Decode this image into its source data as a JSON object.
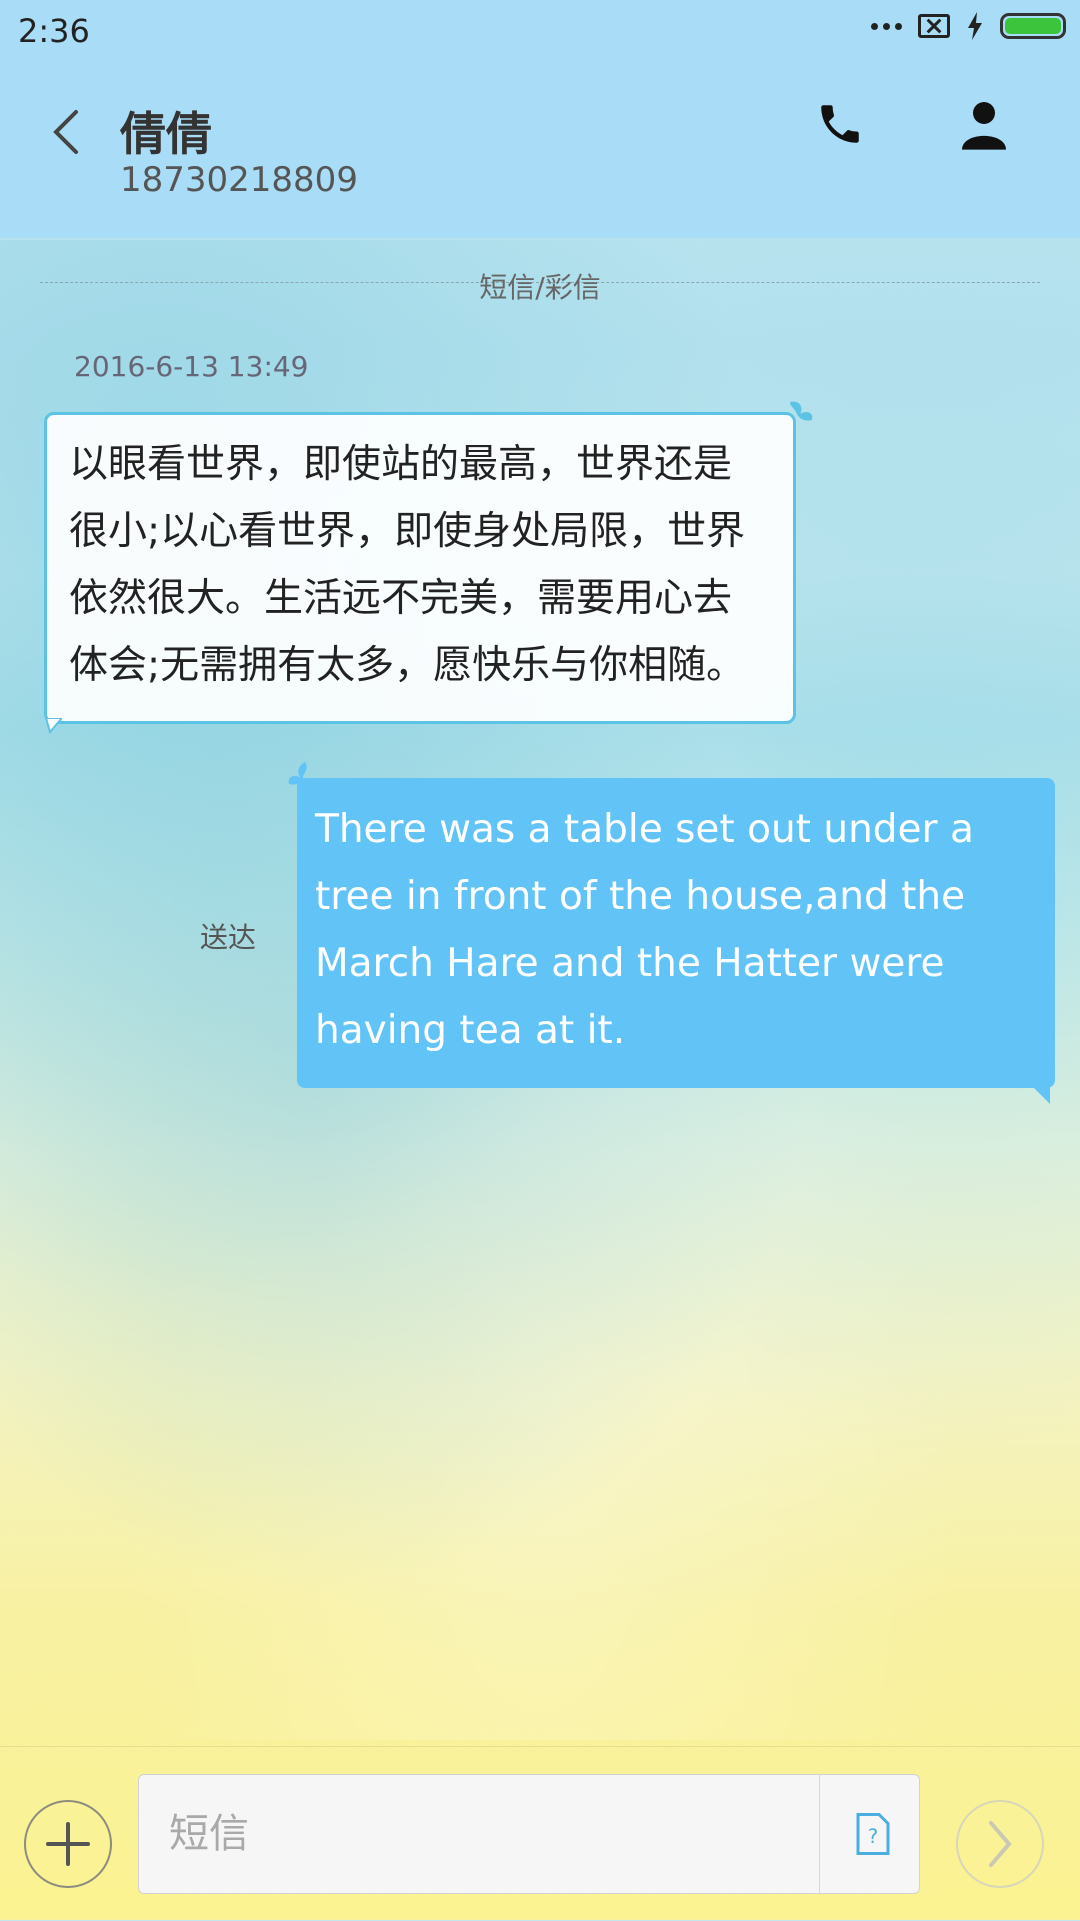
{
  "status_bar": {
    "time": "2:36"
  },
  "header": {
    "contact_name": "倩倩",
    "contact_number": "18730218809",
    "icons": [
      "back-arrow-icon",
      "phone-icon",
      "person-icon"
    ]
  },
  "conversation": {
    "section_label": "短信/彩信",
    "timestamp": "2016-6-13 13:49",
    "incoming_message": {
      "lines": [
        "以眼看世界，即使站的最高，世界还是",
        "很小;以心看世界，即使身处局限，世界",
        "依然很大。生活远不完美，需要用心去",
        "体会;无需拥有太多，愿快乐与你相随。"
      ]
    },
    "outgoing_message": {
      "lines": [
        "There was a table set out under a",
        "tree in front of the house,and the",
        "March Hare and the Hatter were",
        "having tea at it."
      ],
      "status": "送达"
    }
  },
  "input_bar": {
    "placeholder": "短信",
    "icons": [
      "plus-icon",
      "template-icon",
      "send-arrow-icon"
    ]
  },
  "colors": {
    "header_bg": "#a9dcf6",
    "incoming_border": "#5cc3e4",
    "outgoing_bg": "#62c3f7",
    "battery": "#3cc43c"
  }
}
